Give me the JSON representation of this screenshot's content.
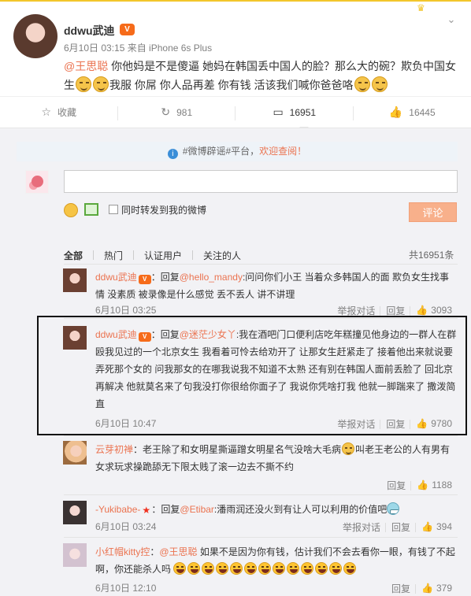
{
  "post": {
    "author": "ddwu武迪",
    "vip_icon": "vip-icon",
    "meta": "6月10日 03:15 来自 iPhone 6s Plus",
    "mention": "@王思聪",
    "text_1": " 你他妈是不是傻逼 她妈在韩国丢中国人的脸？那么大的碗？欺负中国女生",
    "text_2": "我服 你屌 你人品再差 你有钱 活该我们喊你爸爸咯",
    "avatar_icon": "avatar-photo-icon"
  },
  "actions": {
    "favorite_label": "收藏",
    "repost_count": "981",
    "comment_count": "16951",
    "like_count": "16445"
  },
  "notice": {
    "text": "#微博辟谣#平台，",
    "link": "欢迎查阅！"
  },
  "composer": {
    "placeholder": "",
    "repost_label": "同时转发到我的微博",
    "submit_label": "评论"
  },
  "tabs": {
    "items": [
      "全部",
      "热门",
      "认证用户",
      "关注的人"
    ],
    "total_label": "共16951条"
  },
  "comments": [
    {
      "name": "ddwu武迪",
      "prefix": "：回复",
      "mention": "@hello_mandy",
      "text": ":问问你们小王 当着众多韩国人的面 欺负女生找事情 没素质 被录像是什么感觉 丢不丢人 讲不讲理",
      "time": "6月10日 03:25",
      "report": "举报对话",
      "reply": "回复",
      "likes": "3093"
    },
    {
      "name": "ddwu武迪",
      "prefix": "：回复",
      "mention": "@迷茫少女丫",
      "text": ":我在酒吧门口便利店吃年糕撞见他身边的一群人在群殴我见过的一个北京女生 我看着可怜去给劝开了 让那女生赶紧走了 接着他出来就说要弄死那个女的 问我那女的在哪我说我不知道不太熟 还有别在韩国人面前丢脸了 回北京再解决 他就莫名来了句我没打你很给你面子了 我说你凭啥打我 他就一脚踹来了 撒泼简直",
      "time": "6月10日 10:47",
      "report": "举报对话",
      "reply": "回复",
      "likes": "9780"
    },
    {
      "name": "云芽初禅",
      "prefix": "：",
      "mention": "",
      "text": "老王除了和女明星撕逼蹭女明星名气没啥大毛病",
      "text_after": "叫老王老公的人有男有女求玩求操跪舔无下限太贱了滚一边去不撕不约",
      "time": "",
      "report": "",
      "reply": "回复",
      "likes": "1188"
    },
    {
      "name": "-Yukibabe-",
      "prefix": "：回复",
      "mention": "@Etibar",
      "text": ":潘雨润还没火到有让人可以利用的价值吧",
      "time": "6月10日 03:24",
      "report": "举报对话",
      "reply": "回复",
      "likes": "394"
    },
    {
      "name": "小红帽kitty控",
      "prefix": "：",
      "mention": "@王思聪",
      "text": " 如果不是因为你有钱，估计我们不会去看你一眼，有钱了不起啊，你还能杀人吗",
      "time": "6月10日 12:10",
      "report": "",
      "reply": "回复",
      "likes": "379"
    }
  ]
}
